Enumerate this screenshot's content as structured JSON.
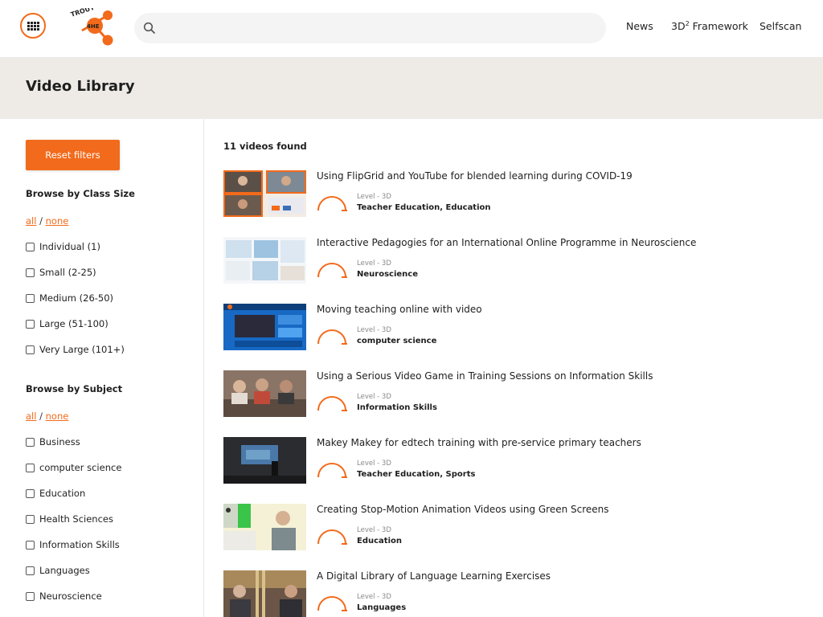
{
  "header": {
    "logo_text": "4HE",
    "logo_top_text": "TROUT",
    "search_placeholder": "",
    "nav": {
      "news": "News",
      "framework": "3D",
      "framework_sup": "2",
      "framework_rest": " Framework",
      "selfscan": "Selfscan"
    }
  },
  "page_title": "Video Library",
  "sidebar": {
    "reset_label": "Reset filters",
    "class_size": {
      "heading": "Browse by Class Size",
      "all": "all",
      "sep": " / ",
      "none": "none",
      "options": [
        "Individual (1)",
        "Small (2-25)",
        "Medium (26-50)",
        "Large (51-100)",
        "Very Large (101+)"
      ]
    },
    "subject": {
      "heading": "Browse by Subject",
      "all": "all",
      "sep": " / ",
      "none": "none",
      "options": [
        "Business",
        "computer science",
        "Education",
        "Health Sciences",
        "Information Skills",
        "Languages",
        "Neuroscience"
      ]
    }
  },
  "results": {
    "count_label": "11 videos found",
    "videos": [
      {
        "title": "Using FlipGrid and YouTube for blended learning during COVID-19",
        "level": "Level - 3D",
        "subjects": "Teacher Education, Education"
      },
      {
        "title": "Interactive Pedagogies for an International Online Programme in Neuroscience",
        "level": "Level - 3D",
        "subjects": "Neuroscience"
      },
      {
        "title": "Moving teaching online with video",
        "level": "Level - 3D",
        "subjects": "computer science"
      },
      {
        "title": "Using a Serious Video Game in Training Sessions on Information Skills",
        "level": "Level - 3D",
        "subjects": "Information Skills"
      },
      {
        "title": "Makey Makey for edtech training with pre-service primary teachers",
        "level": "Level - 3D",
        "subjects": "Teacher Education, Sports"
      },
      {
        "title": "Creating Stop-Motion Animation Videos using Green Screens",
        "level": "Level - 3D",
        "subjects": "Education"
      },
      {
        "title": "A Digital Library of Language Learning Exercises",
        "level": "Level - 3D",
        "subjects": "Languages"
      }
    ]
  },
  "colors": {
    "accent": "#f26a1b",
    "banner": "#eeebe6",
    "text": "#1e1e1e"
  },
  "icons": {
    "apps": "apps-grid-icon",
    "search": "search-icon",
    "level": "level-gauge-icon"
  }
}
